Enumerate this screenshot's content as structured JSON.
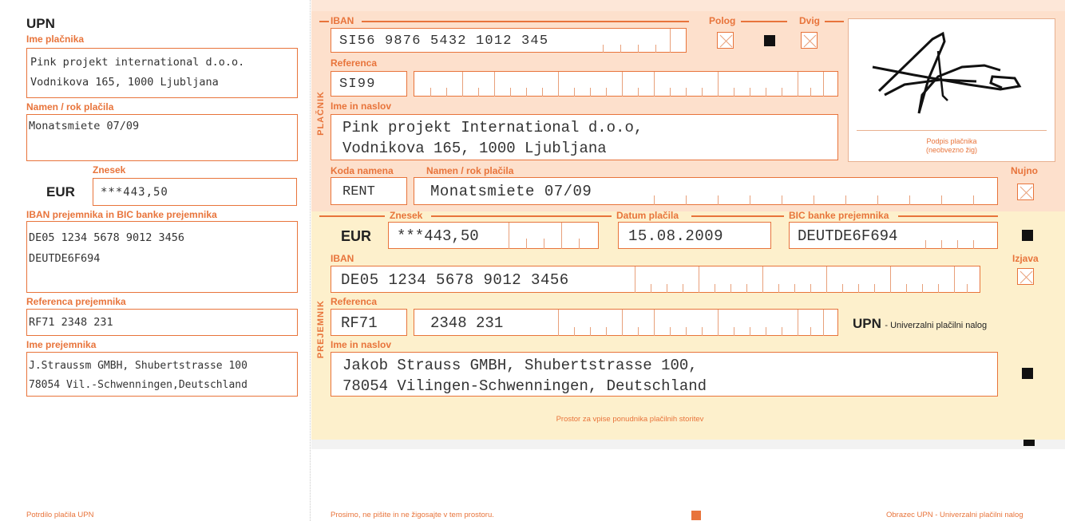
{
  "stub": {
    "title": "UPN",
    "payer_label": "Ime plačnika",
    "payer_line1": "Pink projekt international d.o.o.",
    "payer_line2": "Vodnikova 165, 1000 Ljubljana",
    "purpose_label": "Namen / rok plačila",
    "purpose_value": "Monatsmiete 07/09",
    "amount_label": "Znesek",
    "currency": "EUR",
    "amount_value": "***443,50",
    "iban_bic_label": "IBAN prejemnika in BIC banke prejemnika",
    "iban_value": "DE05 1234 5678 9012 3456",
    "bic_value": "DEUTDE6F694",
    "reference_label": "Referenca prejemnika",
    "reference_value": "RF71 2348 231",
    "recipient_label": "Ime prejemnika",
    "recipient_line1": "J.Straussm GMBH, Shubertstrasse 100",
    "recipient_line2": "78054 Vil.-Schwenningen,Deutschland",
    "footer": "Potrdilo plačila UPN"
  },
  "payer": {
    "side_label": "PLAČNIK",
    "iban_label": "IBAN",
    "iban_value": "SI56 9876 5432 1012 345",
    "deposit_label": "Polog",
    "withdrawal_label": "Dvig",
    "reference_label": "Referenca",
    "reference_model": "SI99",
    "name_label": "Ime in naslov",
    "name_line1": "Pink projekt International d.o.o,",
    "name_line2": "Vodnikova 165, 1000 Ljubljana",
    "signature_label1": "Podpis plačnika",
    "signature_label2": "(neobvezno žig)",
    "purpose_code_label": "Koda namena",
    "purpose_code_value": "RENT",
    "purpose_label": "Namen / rok plačila",
    "purpose_value": "Monatsmiete 07/09",
    "urgent_label": "Nujno"
  },
  "recipient": {
    "side_label": "PREJEMNIK",
    "amount_label": "Znesek",
    "currency": "EUR",
    "amount_value": "***443,50",
    "date_label": "Datum plačila",
    "date_value": "15.08.2009",
    "bic_label": "BIC banke prejemnika",
    "bic_value": "DEUTDE6F694",
    "iban_label": "IBAN",
    "iban_value": "DE05 1234 5678 9012 3456",
    "statement_label": "Izjava",
    "reference_label": "Referenca",
    "reference_model": "RF71",
    "reference_value": "2348 231",
    "upn_title": "UPN",
    "upn_subtitle": "- Univerzalni plačilni nalog",
    "name_label": "Ime in naslov",
    "name_line1": "Jakob Strauss GMBH, Shubertstrasse 100,",
    "name_line2": "78054 Vilingen-Schwenningen, Deutschland",
    "provider_note": "Prostor za vpise ponudnika plačilnih storitev"
  },
  "footer": {
    "note": "Prosimo, ne pišite in ne žigosajte v tem prostoru.",
    "form_name": "Obrazec UPN - Univerzalni plačilni nalog"
  },
  "colors": {
    "accent": "#e8743b",
    "payer_bg": "#fde0cc",
    "recipient_bg": "#fdf0cc"
  }
}
